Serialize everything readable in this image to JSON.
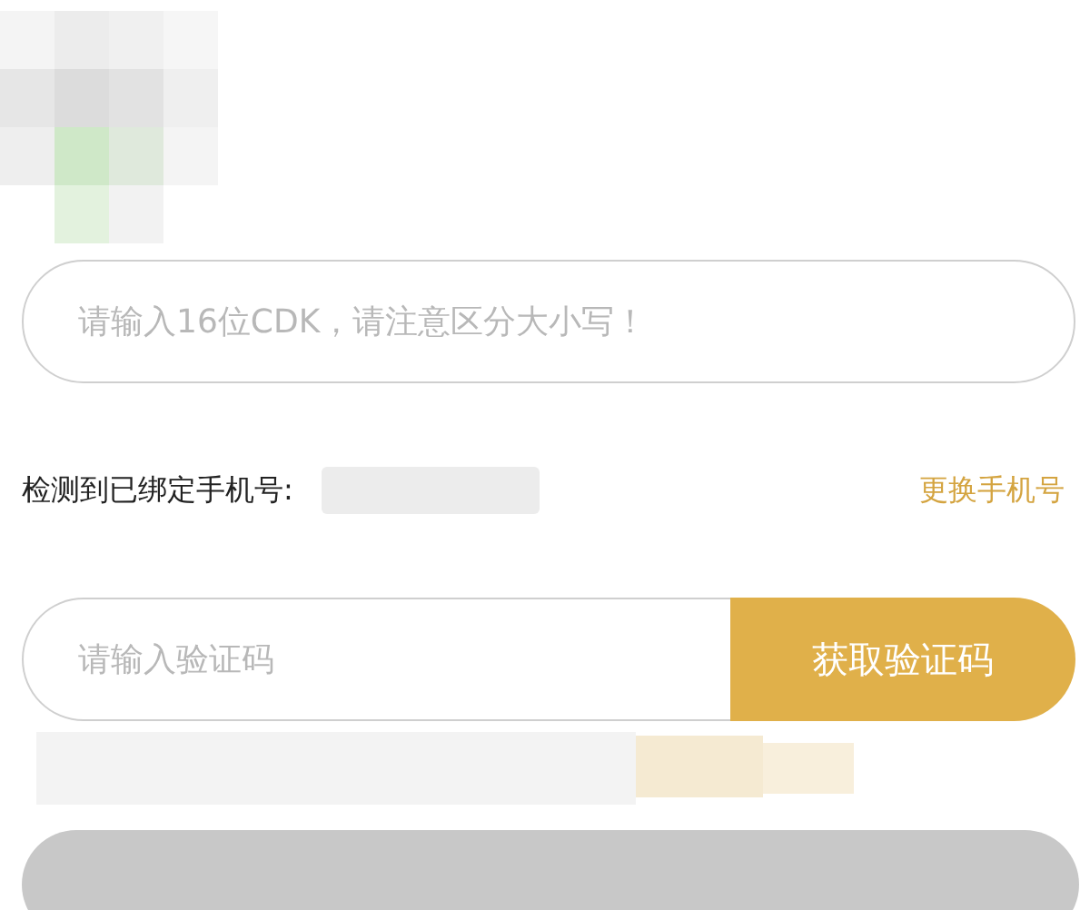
{
  "cdk_field": {
    "placeholder": "请输入16位CDK，请注意区分大小写！"
  },
  "phone_row": {
    "label": "检测到已绑定手机号:",
    "change_link": "更换手机号"
  },
  "code_field": {
    "placeholder": "请输入验证码"
  },
  "get_code_button": {
    "label": "获取验证码"
  }
}
